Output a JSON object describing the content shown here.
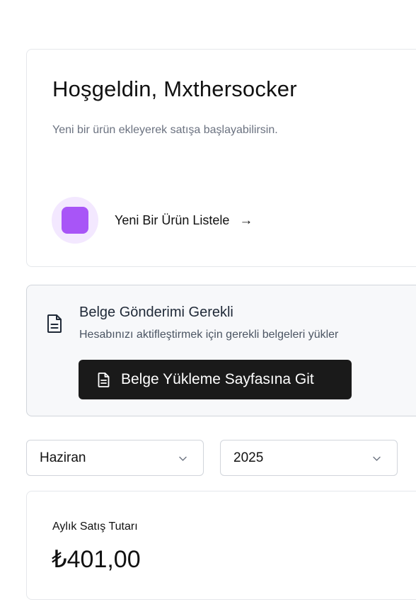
{
  "welcome": {
    "title": "Hoşgeldin, Mxthersocker",
    "subtitle": "Yeni bir ürün ekleyerek satışa başlayabilirsin.",
    "new_product_label": "Yeni Bir Ürün Listele",
    "arrow": "→",
    "accent_color": "#a855f7",
    "accent_bg": "#f3e8ff"
  },
  "doc_notice": {
    "title": "Belge Gönderimi Gerekli",
    "description": "Hesabınızı aktifleştirmek için gerekli belgeleri yükler",
    "button_label": "Belge Yükleme Sayfasına Git",
    "icon": "document-icon"
  },
  "filters": {
    "month": "Haziran",
    "year": "2025",
    "icon": "chevron-down-icon"
  },
  "sales": {
    "label": "Aylık Satış Tutarı",
    "amount": "₺401,00"
  }
}
